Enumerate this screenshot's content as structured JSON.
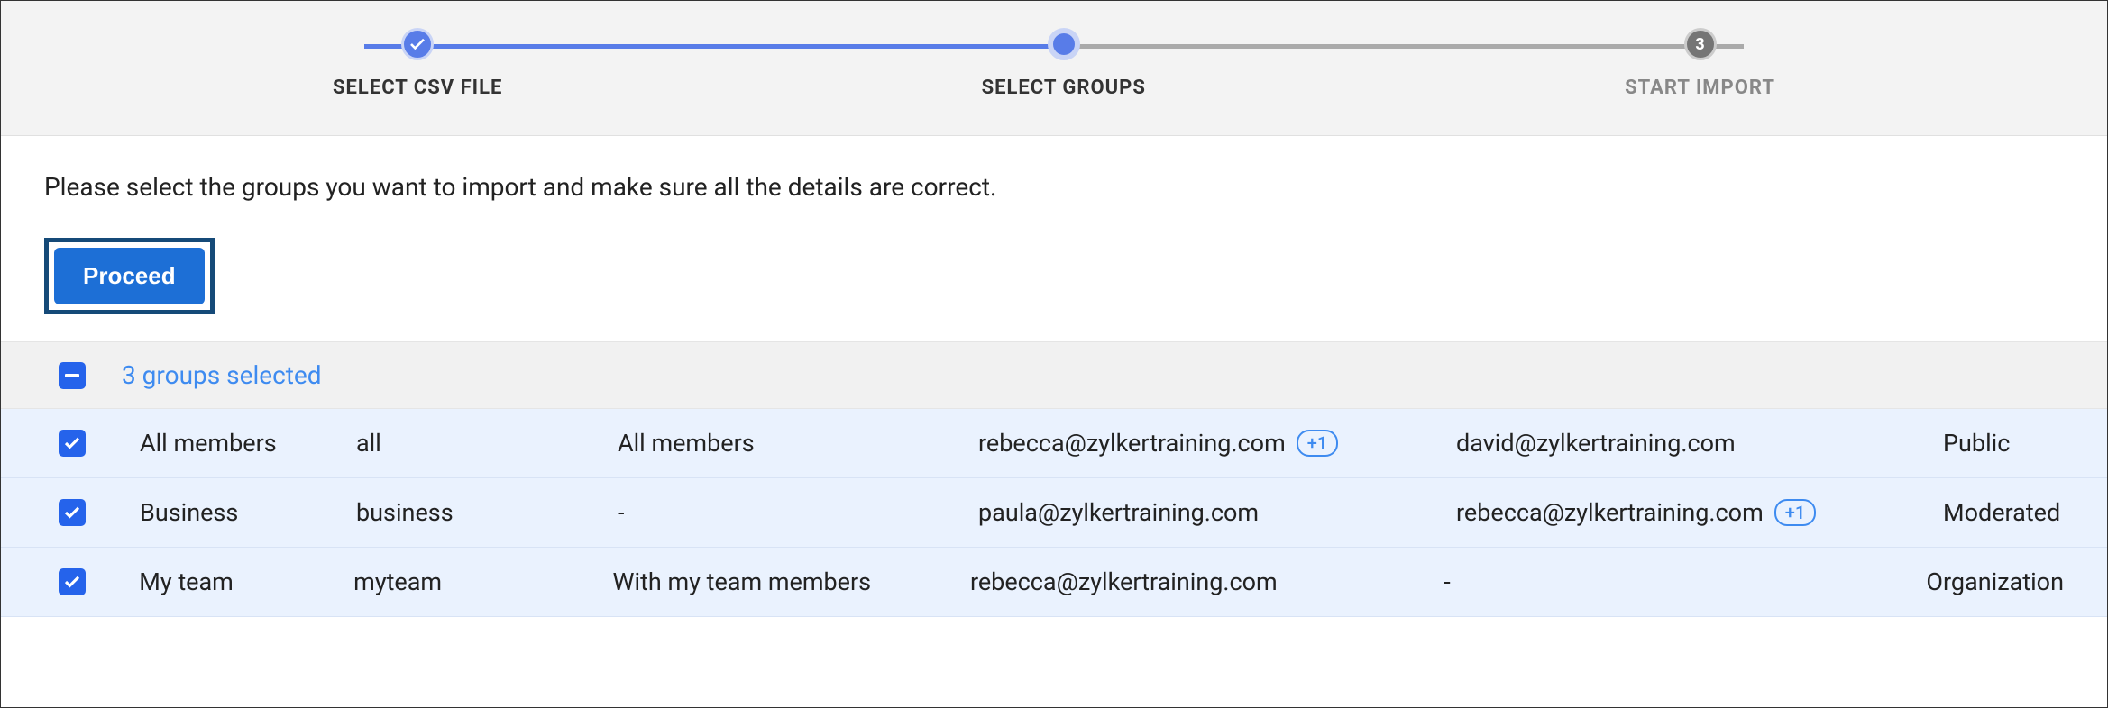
{
  "stepper": {
    "step1": {
      "label": "SELECT CSV FILE"
    },
    "step2": {
      "label": "SELECT GROUPS"
    },
    "step3": {
      "label": "START IMPORT",
      "number": "3"
    }
  },
  "instruction": "Please select the groups you want to import and make sure all the details are correct.",
  "proceed_label": "Proceed",
  "selected_count": "3 groups selected",
  "rows": [
    {
      "name": "All members",
      "alias": "all",
      "desc": "All members",
      "email1": "rebecca@zylkertraining.com",
      "badge1": "+1",
      "email2": "david@zylkertraining.com",
      "badge2": "",
      "type": "Public"
    },
    {
      "name": "Business",
      "alias": "business",
      "desc": "-",
      "email1": "paula@zylkertraining.com",
      "badge1": "",
      "email2": "rebecca@zylkertraining.com",
      "badge2": "+1",
      "type": "Moderated"
    },
    {
      "name": "My team",
      "alias": "myteam",
      "desc": "With my team members",
      "email1": "rebecca@zylkertraining.com",
      "badge1": "",
      "email2": "-",
      "badge2": "",
      "type": "Organization"
    }
  ]
}
